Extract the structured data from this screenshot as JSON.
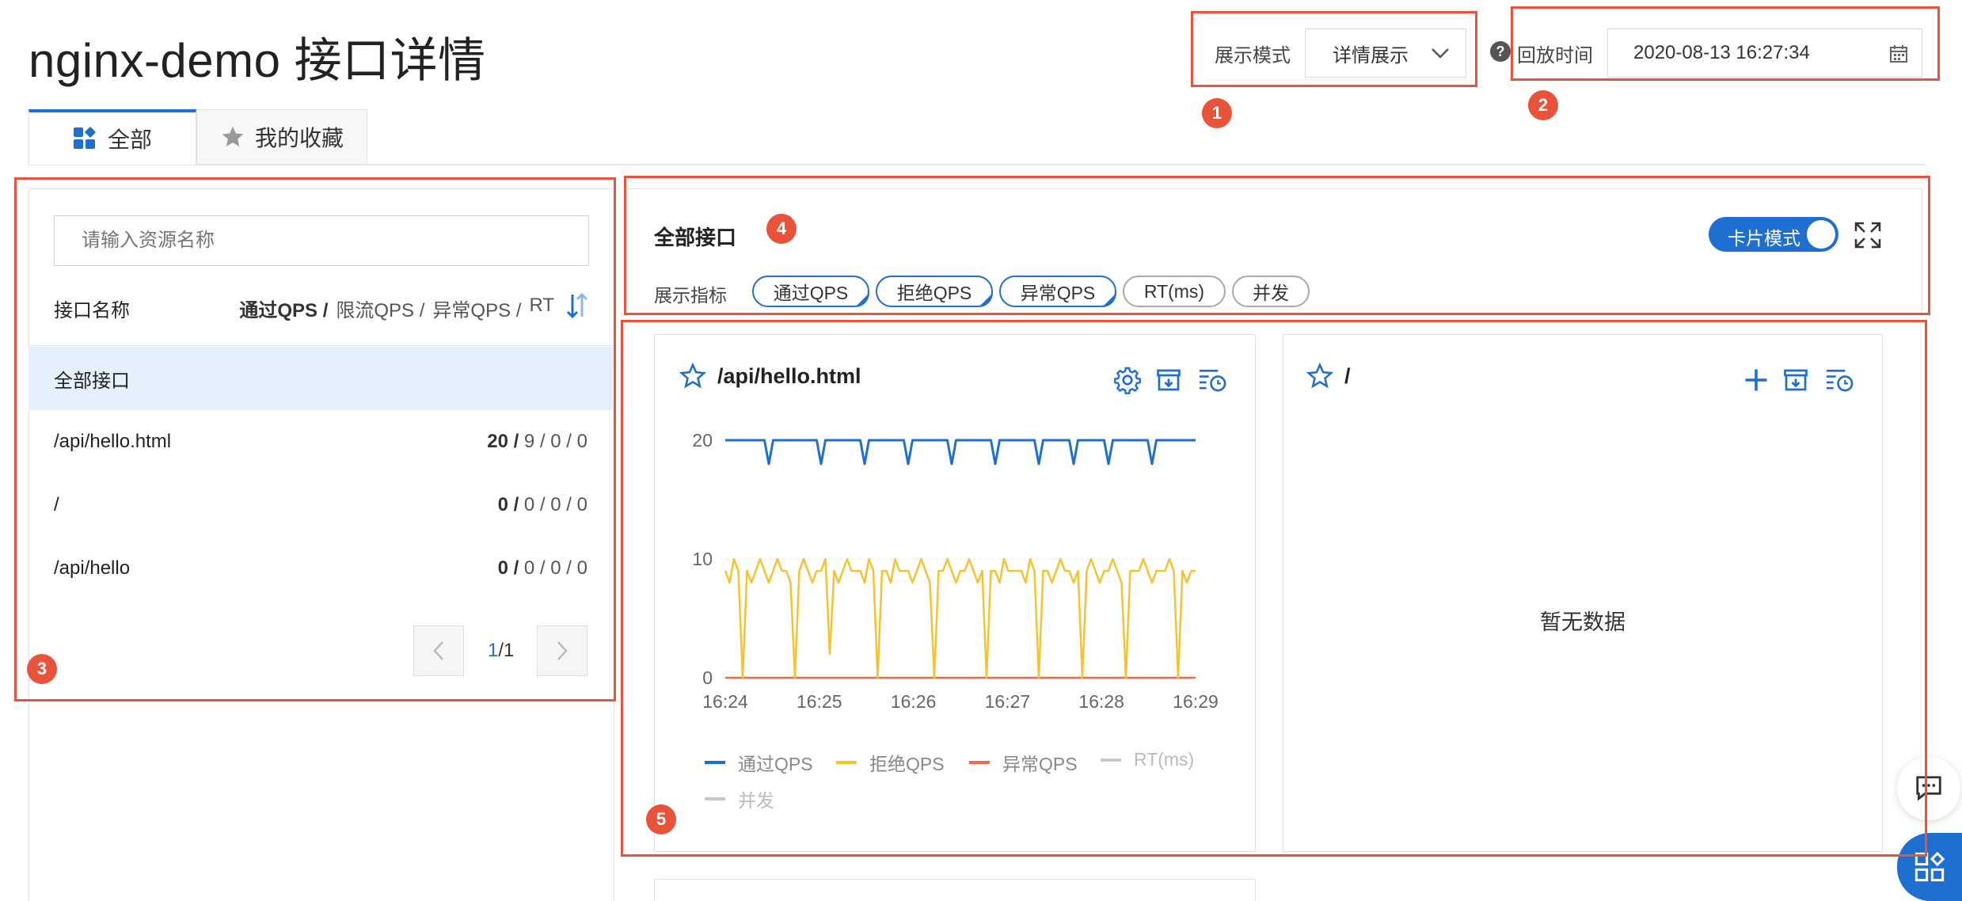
{
  "header": {
    "title": "nginx-demo 接口详情",
    "display_mode_label": "展示模式",
    "display_mode_value": "详情展示",
    "replay_time_label": "回放时间",
    "replay_time_value": "2020-08-13 16:27:34"
  },
  "tabs": [
    {
      "label": "全部",
      "active": true
    },
    {
      "label": "我的收藏",
      "active": false
    }
  ],
  "left_panel": {
    "search_placeholder": "请输入资源名称",
    "col_name": "接口名称",
    "col_metrics": {
      "pass": "通过QPS /",
      "limit": "限流QPS /",
      "error": "异常QPS /",
      "rt": "RT"
    },
    "rows": [
      {
        "name": "全部接口",
        "pass": "",
        "limit": "",
        "error": "",
        "rt": "",
        "selected": true
      },
      {
        "name": "/api/hello.html",
        "pass": "20 /",
        "limit": "9 /",
        "error": "0 /",
        "rt": "0"
      },
      {
        "name": "/",
        "pass": "0 /",
        "limit": "0 /",
        "error": "0 /",
        "rt": "0"
      },
      {
        "name": "/api/hello",
        "pass": "0 /",
        "limit": "0 /",
        "error": "0 /",
        "rt": "0"
      }
    ],
    "pagination": {
      "current": "1",
      "total": "/1"
    }
  },
  "right_header": {
    "title": "全部接口",
    "toggle_label": "卡片模式",
    "metrics_label": "展示指标",
    "metrics": [
      {
        "label": "通过QPS",
        "on": true
      },
      {
        "label": "拒绝QPS",
        "on": true
      },
      {
        "label": "异常QPS",
        "on": true
      },
      {
        "label": "RT(ms)",
        "on": false
      },
      {
        "label": "并发",
        "on": false
      }
    ]
  },
  "cards": [
    {
      "title": "/api/hello.html",
      "empty_text": ""
    },
    {
      "title": "/",
      "empty_text": "暂无数据"
    }
  ],
  "chart_data": {
    "type": "line",
    "title": "",
    "x": [
      "16:24",
      "16:25",
      "16:26",
      "16:27",
      "16:28",
      "16:29"
    ],
    "y_ticks": [
      0,
      10,
      20
    ],
    "ylim": [
      0,
      20
    ],
    "series": [
      {
        "name": "通过QPS",
        "color": "#1f6fd1",
        "values": [
          20,
          20,
          20,
          20,
          20,
          20,
          20,
          20,
          20,
          20,
          18,
          20,
          20,
          20,
          20,
          20,
          20,
          20,
          20,
          20,
          20,
          20,
          18,
          20,
          20,
          20,
          20,
          20,
          20,
          20,
          20,
          20,
          18,
          20,
          20,
          20,
          20,
          20,
          20,
          20,
          20,
          20,
          18,
          20,
          20,
          20,
          20,
          20,
          20,
          20,
          20,
          20,
          18,
          20,
          20,
          20,
          20,
          20,
          20,
          20,
          20,
          20,
          18,
          20,
          20,
          20,
          20,
          20,
          20,
          20,
          20,
          20,
          18,
          20,
          20,
          20,
          20,
          20,
          20,
          20,
          18,
          20,
          20,
          20,
          20,
          20,
          20,
          20,
          18,
          20,
          20,
          20,
          20,
          20,
          20,
          20,
          20,
          20,
          18,
          20,
          20,
          20,
          20,
          20,
          20,
          20,
          20,
          20,
          20
        ]
      },
      {
        "name": "拒绝QPS",
        "color": "#f6c230",
        "values": [
          9,
          8,
          10,
          9,
          0,
          9,
          8,
          9,
          10,
          9,
          8,
          9,
          10,
          9,
          9,
          8,
          0,
          9,
          10,
          9,
          8,
          9,
          9,
          10,
          2,
          9,
          8,
          9,
          10,
          9,
          9,
          9,
          8,
          10,
          9,
          0,
          9,
          9,
          8,
          10,
          9,
          9,
          9,
          8,
          9,
          10,
          9,
          8,
          0,
          9,
          9,
          10,
          9,
          8,
          9,
          9,
          10,
          9,
          8,
          9,
          0,
          9,
          9,
          8,
          10,
          9,
          9,
          9,
          9,
          8,
          10,
          9,
          0,
          9,
          9,
          8,
          9,
          10,
          9,
          9,
          8,
          9,
          0,
          9,
          10,
          9,
          8,
          9,
          9,
          10,
          9,
          8,
          0,
          9,
          9,
          9,
          10,
          9,
          8,
          9,
          9,
          9,
          10,
          9,
          0,
          9,
          8,
          9,
          9
        ]
      },
      {
        "name": "异常QPS",
        "color": "#ee6a4c",
        "values": [
          0,
          0,
          0,
          0,
          0,
          0,
          0,
          0,
          0,
          0
        ]
      },
      {
        "name": "RT(ms)",
        "color": "#c8c8c8",
        "values": []
      },
      {
        "name": "并发",
        "color": "#c8c8c8",
        "values": []
      }
    ]
  },
  "annotations": [
    "1",
    "2",
    "3",
    "4",
    "5"
  ],
  "colors": {
    "accent": "#1f6fd1",
    "annotation": "#e8533a",
    "selected_row": "#e4f0fc"
  }
}
